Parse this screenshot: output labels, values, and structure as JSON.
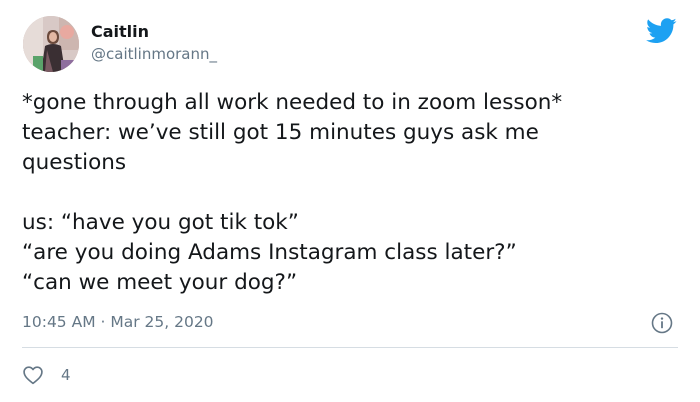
{
  "author": {
    "display_name": "Caitlin",
    "handle": "@caitlinmorann_"
  },
  "tweet": {
    "lines": [
      "*gone through all work needed to in zoom lesson*",
      "teacher: we’ve still got 15 minutes guys ask me",
      "questions",
      "us: “have you got tik tok”",
      "“are you doing Adams Instagram class later?”",
      "“can we meet your dog?”"
    ],
    "timestamp": "10:45 AM · Mar 25, 2020",
    "like_count": "4"
  },
  "icons": {
    "brand": "twitter-bird-icon",
    "info": "info-icon",
    "like": "heart-icon"
  },
  "colors": {
    "brand": "#1da1f2",
    "text": "#14171a",
    "secondary": "#657786",
    "divider": "#d6dde3"
  }
}
